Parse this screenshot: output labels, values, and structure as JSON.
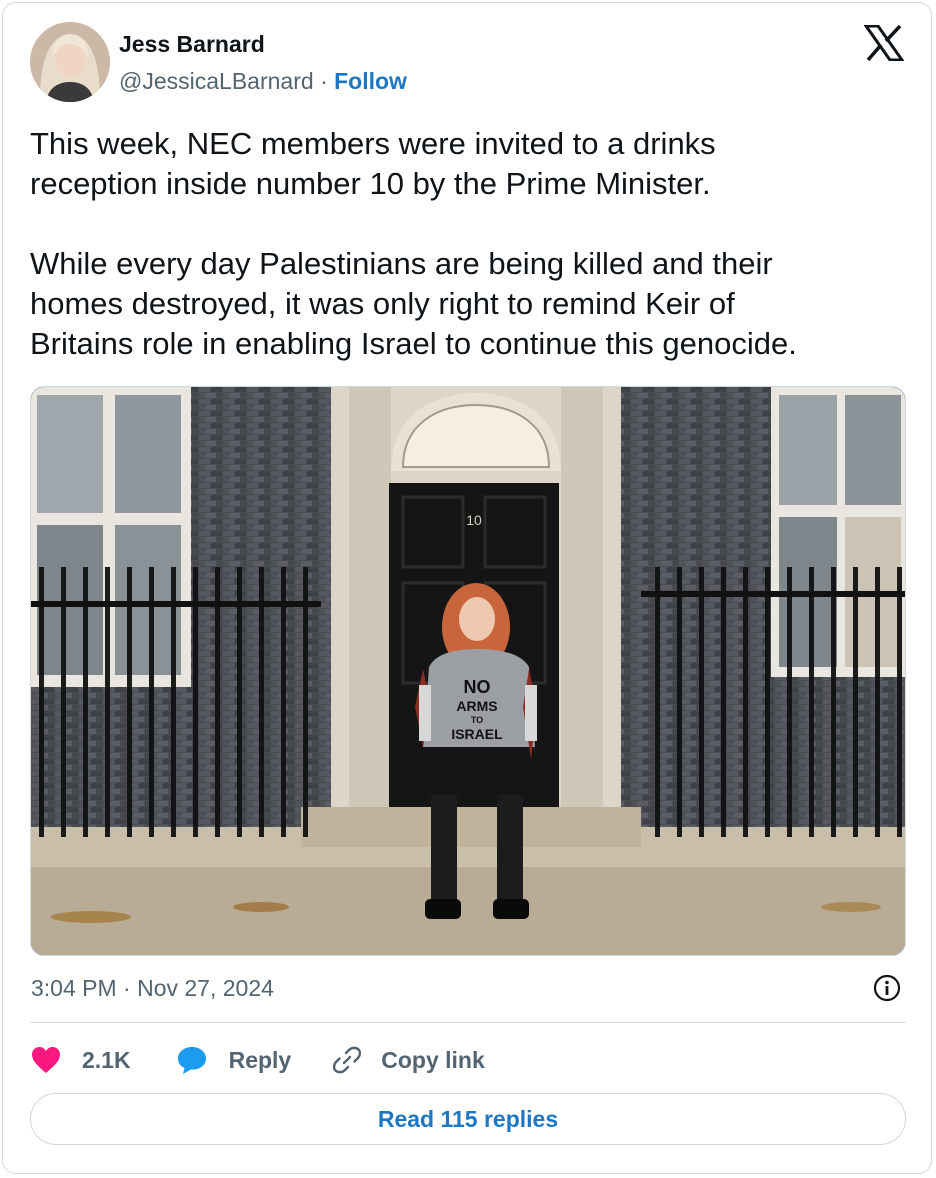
{
  "author": {
    "name": "Jess Barnard",
    "handle": "@JessicaLBarnard",
    "separator": "·",
    "follow_label": "Follow"
  },
  "tweet": {
    "text": "This week, NEC members were invited to a drinks\nreception inside number 10 by the Prime Minister.\n\nWhile every day Palestinians are being killed and their\nhomes destroyed, it was only right to remind Keir of\nBritains role in enabling Israel to continue this genocide.",
    "photo": {
      "door_number": "10",
      "shirt_text": [
        "NO",
        "ARMS",
        "TO",
        "ISRAEL"
      ]
    },
    "timestamp": "3:04 PM · Nov 27, 2024"
  },
  "actions": {
    "like_count": "2.1K",
    "reply_label": "Reply",
    "copy_link_label": "Copy link"
  },
  "read_replies_label": "Read 115 replies",
  "colors": {
    "accent": "#1d77c3",
    "like": "#f91880",
    "reply_icon": "#1d9bf0",
    "muted": "#536471",
    "border": "#cfd9de"
  },
  "icons": [
    "x-logo-icon",
    "heart-icon",
    "speech-bubble-icon",
    "link-icon",
    "info-icon"
  ]
}
